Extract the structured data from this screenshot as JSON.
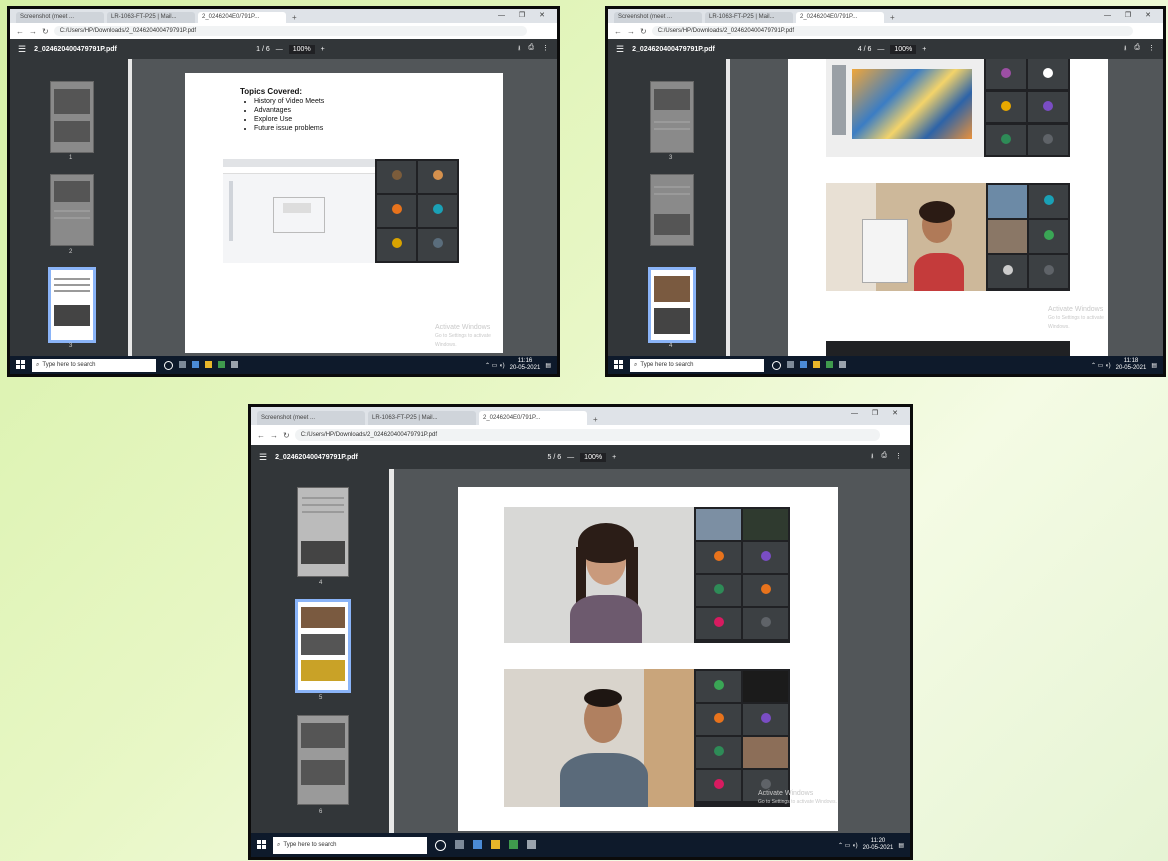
{
  "screens": [
    {
      "tabs": [
        "Screenshot (meet ...",
        "LR-1063-FT-P25 | Mail...",
        "2_0246204E0/791P...",
        "+"
      ],
      "url": "C:/Users/HP/Downloads/2_024620400479791P.pdf",
      "filename": "2_024620400479791P.pdf",
      "page_display": "1 / 6",
      "zoom": "100%",
      "thumb_numbers": [
        "1",
        "2",
        "3"
      ],
      "content_title": "Topics Covered:",
      "content_items": [
        "History of Video Meets",
        "Advantages",
        "Explore Use",
        "Future issue problems"
      ],
      "watermark_1": "Activate Windows",
      "watermark_2": "Go to Settings to activate Windows.",
      "search_placeholder": "Type here to search",
      "time": "11:16",
      "date": "20-05-2021"
    },
    {
      "tabs": [
        "Screenshot (meet ...",
        "LR-1063-FT-P25 | Mail...",
        "2_0246204E0/791P...",
        "+"
      ],
      "url": "C:/Users/HP/Downloads/2_024620400479791P.pdf",
      "filename": "2_024620400479791P.pdf",
      "page_display": "4 / 6",
      "zoom": "100%",
      "thumb_numbers": [
        "3",
        "4"
      ],
      "watermark_1": "Activate Windows",
      "watermark_2": "Go to Settings to activate Windows.",
      "search_placeholder": "Type here to search",
      "time": "11:18",
      "date": "20-05-2021"
    },
    {
      "tabs": [
        "Screenshot (meet ...",
        "LR-1063-FT-P25 | Mail...",
        "2_0246204E0/791P...",
        "+"
      ],
      "url": "C:/Users/HP/Downloads/2_024620400479791P.pdf",
      "filename": "2_024620400479791P.pdf",
      "page_display": "5 / 6",
      "zoom": "100%",
      "thumb_numbers": [
        "4",
        "5",
        "6"
      ],
      "watermark_1": "Activate Windows",
      "watermark_2": "Go to Settings to activate Windows.",
      "search_placeholder": "Type here to search",
      "time": "11:20",
      "date": "20-05-2021"
    }
  ],
  "colors": {
    "background": "#dff3b4",
    "pdf_toolbar": "#323639",
    "viewer_bg": "#525659",
    "taskbar": "#0e1a2b",
    "meet_bg": "#202124",
    "thumb_highlight": "#8ab4f8"
  },
  "icons": [
    "menu-icon",
    "back-icon",
    "forward-icon",
    "reload-icon",
    "download-icon",
    "print-icon",
    "more-icon",
    "windows-start-icon",
    "search-icon"
  ]
}
